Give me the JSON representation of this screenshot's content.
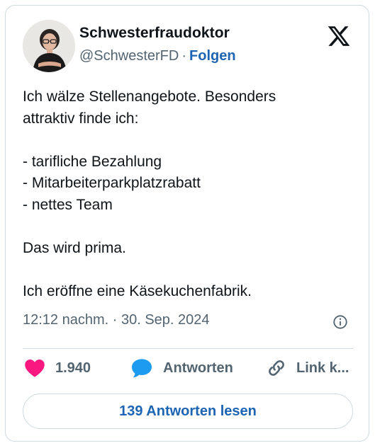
{
  "author": {
    "display_name": "Schwesterfraudoktor",
    "handle": "@SchwesterFD",
    "separator": "·",
    "follow_label": "Folgen"
  },
  "tweet": {
    "lines": [
      "Ich wälze Stellenangebote. Besonders",
      "attraktiv finde ich:",
      "",
      "- tarifliche Bezahlung",
      "- Mitarbeiterparkplatzrabatt",
      "- nettes Team",
      "",
      "Das wird prima.",
      "",
      "Ich eröffne eine Käsekuchenfabrik."
    ],
    "timestamp": "12:12 nachm. · 30. Sep. 2024"
  },
  "actions": {
    "like_count": "1.940",
    "reply_label": "Antworten",
    "link_label": "Link k..."
  },
  "read_replies_label": "139 Antworten lesen",
  "icons": {
    "x": "x-logo-icon",
    "info": "info-icon",
    "like": "heart-icon",
    "reply": "speech-bubble-icon",
    "link": "link-chain-icon"
  },
  "colors": {
    "heart": "#f91880",
    "reply_bubble": "#1d9bf0",
    "link_blue": "#1d64b3",
    "secondary_text": "#536471",
    "primary_text": "#0f1419",
    "border": "#cfd9de"
  }
}
